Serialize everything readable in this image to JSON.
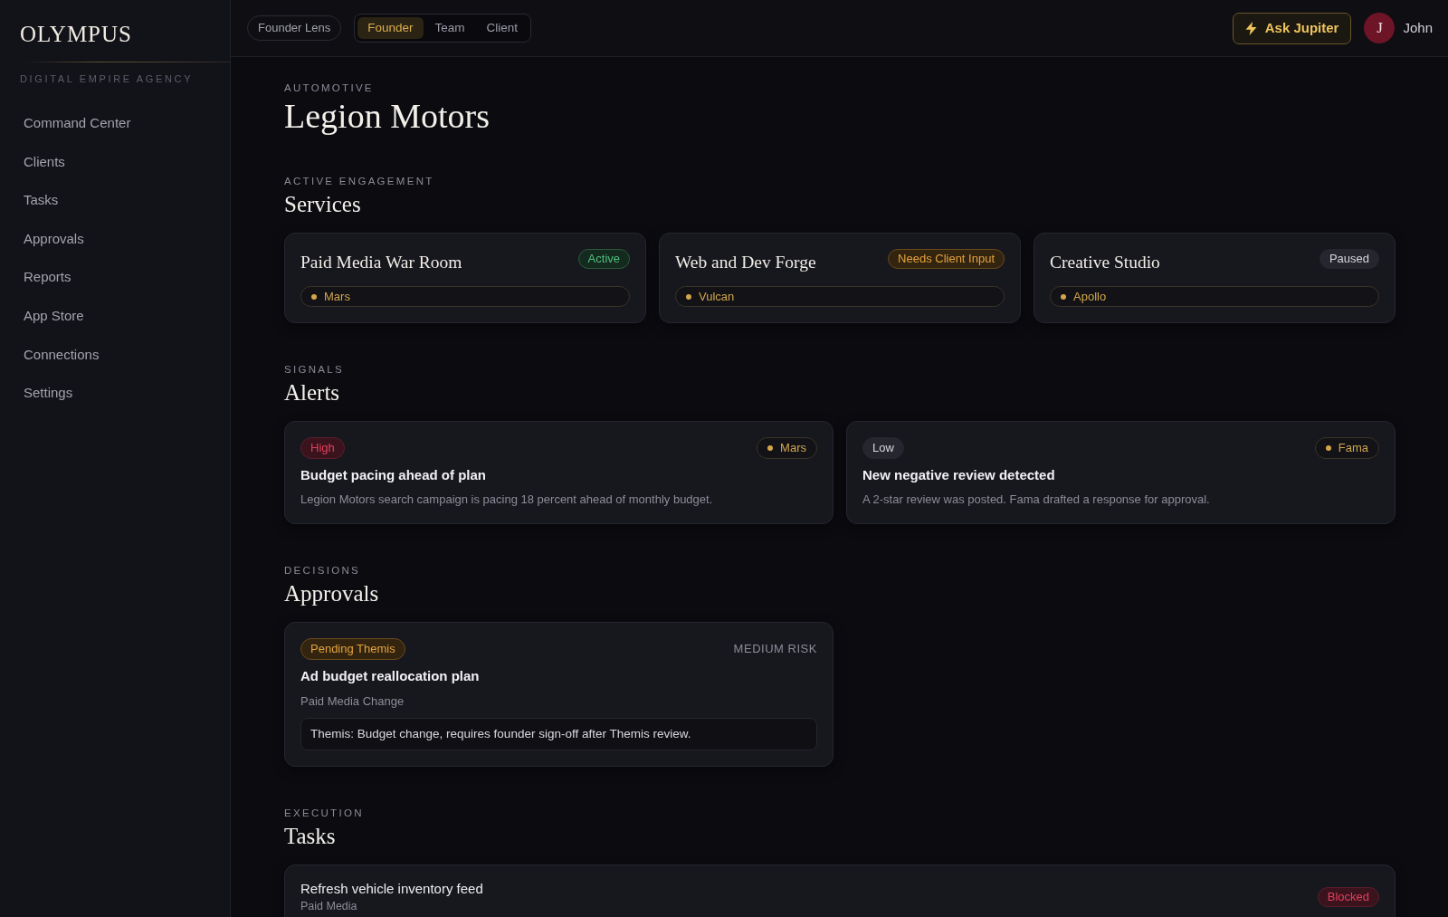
{
  "sidebar": {
    "logo": "OLYMPUS",
    "tagline": "DIGITAL EMPIRE AGENCY",
    "items": [
      {
        "label": "Command Center",
        "selected": false
      },
      {
        "label": "Clients",
        "selected": false
      },
      {
        "label": "Tasks",
        "selected": false
      },
      {
        "label": "Approvals",
        "selected": false
      },
      {
        "label": "Reports",
        "selected": false
      },
      {
        "label": "App Store",
        "selected": false
      },
      {
        "label": "Connections",
        "selected": false
      },
      {
        "label": "Settings",
        "selected": false
      }
    ]
  },
  "topbar": {
    "lens_label": "Founder Lens",
    "lens_tabs": [
      {
        "label": "Founder",
        "selected": true
      },
      {
        "label": "Team",
        "selected": false
      },
      {
        "label": "Client",
        "selected": false
      }
    ],
    "ask_button": "Ask Jupiter",
    "user": {
      "initial": "J",
      "name": "John"
    }
  },
  "client": {
    "industry": "AUTOMOTIVE",
    "name": "Legion Motors"
  },
  "services": {
    "eyebrow": "ACTIVE ENGAGEMENT",
    "title": "Services",
    "cards": [
      {
        "name": "Paid Media War Room",
        "status": {
          "label": "Active",
          "kind": "success"
        },
        "agent": "Mars"
      },
      {
        "name": "Web and Dev Forge",
        "status": {
          "label": "Needs Client Input",
          "kind": "warning"
        },
        "agent": "Vulcan"
      },
      {
        "name": "Creative Studio",
        "status": {
          "label": "Paused",
          "kind": "neutral"
        },
        "agent": "Apollo"
      }
    ]
  },
  "alerts": {
    "eyebrow": "SIGNALS",
    "title": "Alerts",
    "cards": [
      {
        "severity": {
          "label": "High",
          "kind": "danger"
        },
        "agent": "Mars",
        "title": "Budget pacing ahead of plan",
        "description": "Legion Motors search campaign is pacing 18 percent ahead of monthly budget."
      },
      {
        "severity": {
          "label": "Low",
          "kind": "neutral"
        },
        "agent": "Fama",
        "title": "New negative review detected",
        "description": "A 2-star review was posted. Fama drafted a response for approval."
      }
    ]
  },
  "approvals": {
    "eyebrow": "DECISIONS",
    "title": "Approvals",
    "cards": [
      {
        "status": {
          "label": "Pending Themis",
          "kind": "warning"
        },
        "risk": "MEDIUM RISK",
        "title": "Ad budget reallocation plan",
        "category": "Paid Media Change",
        "note": "Themis: Budget change, requires founder sign-off after Themis review."
      }
    ]
  },
  "tasks": {
    "eyebrow": "EXECUTION",
    "title": "Tasks",
    "cards": [
      {
        "title": "Refresh vehicle inventory feed",
        "category": "Paid Media",
        "status": {
          "label": "Blocked",
          "kind": "danger"
        }
      }
    ]
  }
}
